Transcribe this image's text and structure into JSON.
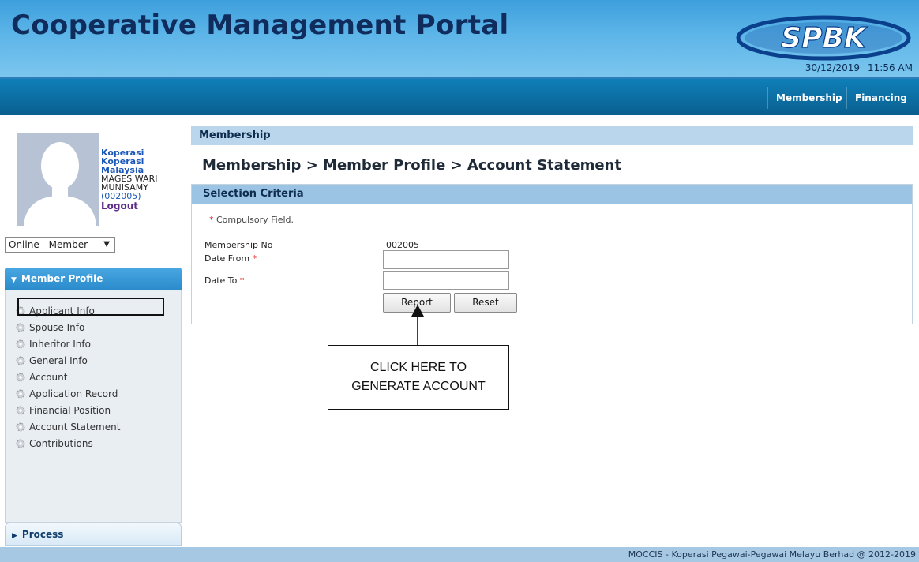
{
  "header": {
    "title": "Cooperative Management Portal",
    "logo_text": "SPBK",
    "date": "30/12/2019",
    "time": "11:56 AM"
  },
  "nav": {
    "items": [
      {
        "label": "Membership"
      },
      {
        "label": "Financing"
      }
    ]
  },
  "user": {
    "coop_line1": "Koperasi",
    "coop_line2": "Koperasi",
    "coop_line3": "Malaysia",
    "name_line1": "MAGES WARI",
    "name_line2": "MUNISAMY",
    "member_id": "(002005)",
    "logout_label": "Logout",
    "role_selected": "Online - Member"
  },
  "sidebar": {
    "section_label": "Member Profile",
    "items": [
      {
        "label": "Applicant Info"
      },
      {
        "label": "Spouse Info"
      },
      {
        "label": "Inheritor Info"
      },
      {
        "label": "General Info"
      },
      {
        "label": "Account"
      },
      {
        "label": "Application Record"
      },
      {
        "label": "Financial Position"
      },
      {
        "label": "Account Statement"
      },
      {
        "label": "Contributions"
      }
    ],
    "process_label": "Process"
  },
  "main": {
    "section_title": "Membership",
    "breadcrumb": "Membership > Member Profile > Account Statement",
    "criteria_title": "Selection Criteria",
    "compulsory_note": "Compulsory Field.",
    "fields": {
      "membership_label": "Membership No",
      "membership_value": "002005",
      "date_from_label": "Date From",
      "date_to_label": "Date To",
      "date_from_value": "",
      "date_to_value": ""
    },
    "buttons": {
      "report": "Report",
      "reset": "Reset"
    }
  },
  "annotation": {
    "line1": "CLICK HERE TO",
    "line2": "GENERATE ACCOUNT"
  },
  "footer": {
    "text": "MOCCIS - Koperasi Pegawai-Pegawai Melayu Berhad @ 2012-2019"
  },
  "colors": {
    "header_blue": "#5db5e8",
    "nav_blue": "#0c6ca0",
    "accent_blue": "#2b8ccc",
    "required_red": "#e02020"
  }
}
